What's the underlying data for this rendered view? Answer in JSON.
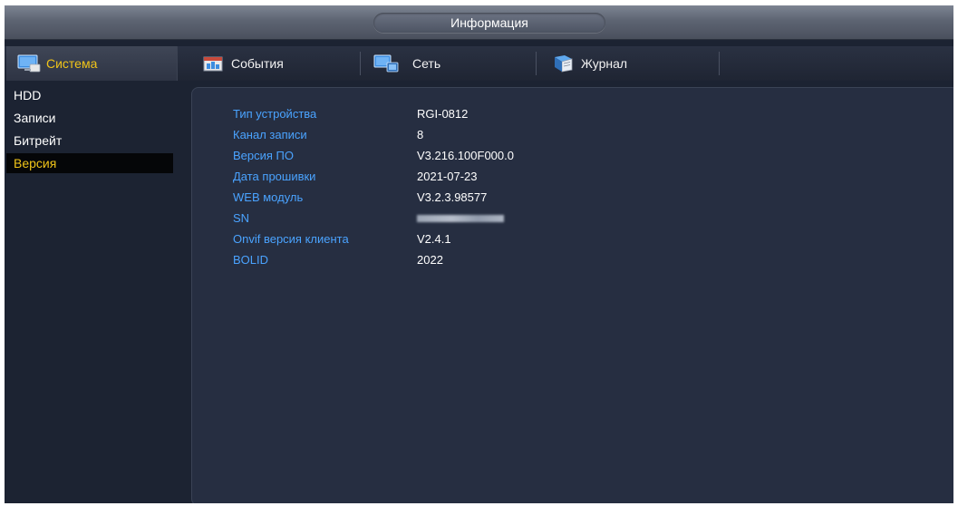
{
  "window": {
    "title": "Информация"
  },
  "tabs": [
    {
      "label": "Система",
      "icon": "monitor-icon",
      "active": true
    },
    {
      "label": "События",
      "icon": "events-icon",
      "active": false
    },
    {
      "label": "Сеть",
      "icon": "network-icon",
      "active": false
    },
    {
      "label": "Журнал",
      "icon": "log-icon",
      "active": false
    }
  ],
  "sidebar": {
    "items": [
      {
        "label": "HDD",
        "active": false
      },
      {
        "label": "Записи",
        "active": false
      },
      {
        "label": "Битрейт",
        "active": false
      },
      {
        "label": "Версия",
        "active": true
      }
    ]
  },
  "info": {
    "rows": [
      {
        "label": "Тип устройства",
        "value": "RGI-0812"
      },
      {
        "label": "Канал записи",
        "value": "8"
      },
      {
        "label": "Версия ПО",
        "value": "V3.216.100F000.0"
      },
      {
        "label": "Дата прошивки",
        "value": "2021-07-23"
      },
      {
        "label": "WEB модуль",
        "value": "V3.2.3.98577"
      },
      {
        "label": "SN",
        "value": ""
      },
      {
        "label": "Onvif версия клиента",
        "value": "V2.4.1"
      },
      {
        "label": "BOLID",
        "value": "2022"
      }
    ]
  },
  "colors": {
    "accent_active": "#f0c419",
    "label_blue": "#4aa3ff",
    "panel_bg": "#262e41",
    "frame_bg": "#1c2332"
  }
}
